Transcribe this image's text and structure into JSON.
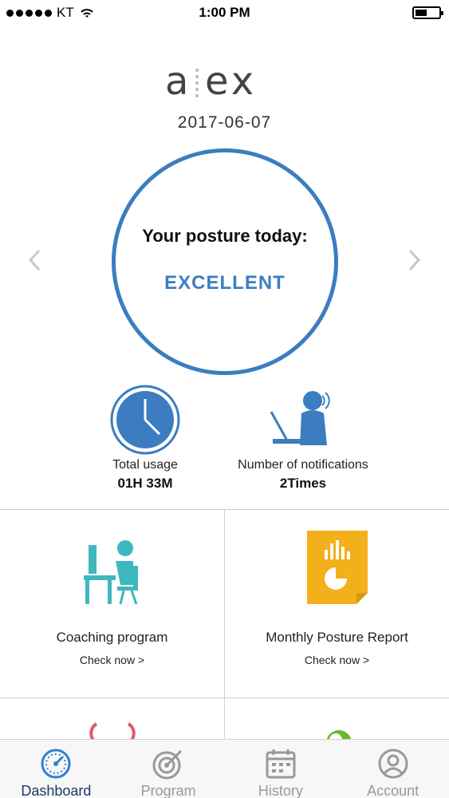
{
  "status_bar": {
    "carrier": "KT",
    "time": "1:00 PM"
  },
  "header": {
    "logo": "alex",
    "date": "2017-06-07"
  },
  "posture": {
    "question": "Your posture today:",
    "result": "EXCELLENT"
  },
  "stats": {
    "usage": {
      "label": "Total usage",
      "value": "01H 33M"
    },
    "notifications": {
      "label": "Number of notifications",
      "value": "2Times"
    }
  },
  "cards": [
    {
      "title": "Coaching program",
      "link": "Check now >"
    },
    {
      "title": "Monthly Posture Report",
      "link": "Check now >"
    }
  ],
  "tabs": [
    {
      "label": "Dashboard",
      "icon": "speedometer-icon",
      "active": true
    },
    {
      "label": "Program",
      "icon": "target-icon",
      "active": false
    },
    {
      "label": "History",
      "icon": "calendar-icon",
      "active": false
    },
    {
      "label": "Account",
      "icon": "user-icon",
      "active": false
    }
  ],
  "colors": {
    "accent": "#3b7dc0",
    "teal": "#3fb7bf",
    "report": "#f2b11b",
    "active_tab": "#1d3a6b"
  }
}
